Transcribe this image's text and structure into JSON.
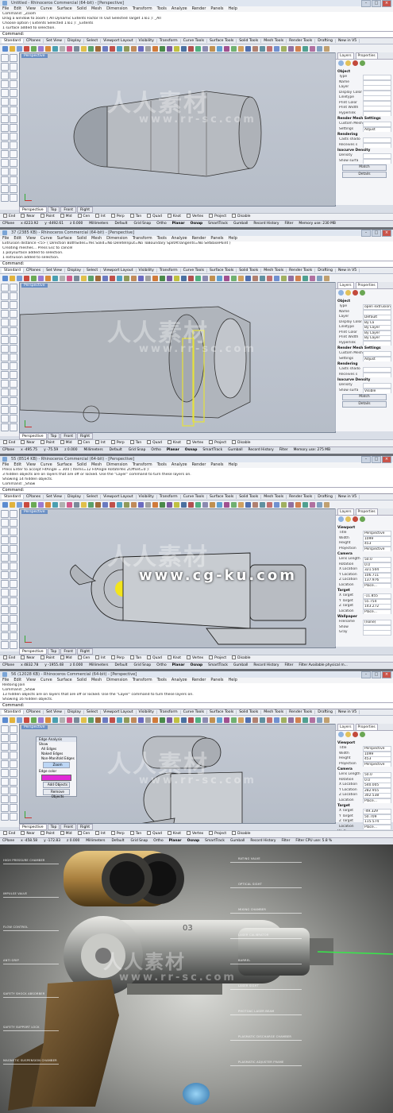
{
  "menu": [
    "File",
    "Edit",
    "View",
    "Curve",
    "Surface",
    "Solid",
    "Mesh",
    "Dimension",
    "Transform",
    "Tools",
    "Analyze",
    "Render",
    "Panels",
    "Help"
  ],
  "tabs": [
    "Standard",
    "CPlanes",
    "Set View",
    "Display",
    "Select",
    "Viewport Layout",
    "Visibility",
    "Transform",
    "Curve Tools",
    "Surface Tools",
    "Solid Tools",
    "Mesh Tools",
    "Render Tools",
    "Drafting",
    "New in V5"
  ],
  "viewport_tabs": [
    "Perspective",
    "Top",
    "Front",
    "Right"
  ],
  "osnaps": [
    "End",
    "Near",
    "Point",
    "Mid",
    "Cen",
    "Int",
    "Perp",
    "Tan",
    "Quad",
    "Knot",
    "Vertex",
    "Project",
    "Disable"
  ],
  "status_toggles": [
    "Grid Snap",
    "Ortho",
    "Planar",
    "Osnap",
    "SmartTrack",
    "Gumball",
    "Record History",
    "Filter"
  ],
  "colors": {
    "accent": "#6a8fc4",
    "bg": "#d9dee7",
    "viewport": "#c0c6d0",
    "magenta": "#e02ad6"
  },
  "screens": [
    {
      "title": "Untitled - Rhinoceros Commercial (64-bit) - [Perspective]",
      "history": [
        "Command: _Zoom",
        "Drag a window to zoom ( All  Dynamic  Extents  Factor  In  Out  Selected  Target  1To1 ): _All",
        "Choose option ( Extents  Selected  1To1 ): _Extents",
        "1 surface added to selection."
      ],
      "command": "Command:",
      "viewport_label": "Perspective",
      "panel_tabs": [
        "Layers",
        "Properties"
      ],
      "panel": [
        {
          "section": "Object"
        },
        {
          "k": "Type",
          "v": ""
        },
        {
          "k": "Name",
          "v": ""
        },
        {
          "k": "Layer",
          "v": ""
        },
        {
          "k": "Display Color",
          "v": ""
        },
        {
          "k": "Linetype",
          "v": ""
        },
        {
          "k": "Print Color",
          "v": ""
        },
        {
          "k": "Print Width",
          "v": ""
        },
        {
          "k": "Hyperlink",
          "v": ""
        },
        {
          "section": "Render Mesh Settings"
        },
        {
          "k": "Custom Mesh",
          "v": ""
        },
        {
          "k": "Settings",
          "v": "Adjust"
        },
        {
          "section": "Rendering"
        },
        {
          "k": "Casts shado",
          "v": ""
        },
        {
          "k": "Receives s",
          "v": ""
        },
        {
          "section": "Isocurve Density"
        },
        {
          "k": "Density",
          "v": ""
        },
        {
          "k": "Show surfa",
          "v": ""
        }
      ],
      "panel_buttons": [
        "Match",
        "Details"
      ],
      "status": {
        "cplane": "CPlane",
        "x": "x 4223.92",
        "y": "y -4492.61",
        "z": "z 0.000",
        "units": "Millimeters",
        "layer": "Default",
        "extra": "Memory use: 230 MB"
      }
    },
    {
      "title": "37 (2385 KB) - Rhinoceros Commercial (64-bit) - [Perspective]",
      "history": [
        "Extrusion distance <5> ( Direction  BothSides=Yes  Solid=No  DeleteInput=No  ToBoundary  SplitAtTangents=No  SetBasePoint )",
        "Creating meshes... Press Esc to cancel",
        "1 polysurface added to selection.",
        "1 extrusion added to selection."
      ],
      "command": "Command:",
      "viewport_label": "Perspective",
      "panel_tabs": [
        "Layers",
        "Properties"
      ],
      "panel": [
        {
          "section": "Object"
        },
        {
          "k": "Type",
          "v": "open extrusion"
        },
        {
          "k": "Name",
          "v": ""
        },
        {
          "k": "Layer",
          "v": "Default"
        },
        {
          "k": "Display Color",
          "v": "By La"
        },
        {
          "k": "Linetype",
          "v": "By Layer"
        },
        {
          "k": "Print Color",
          "v": "By Layer"
        },
        {
          "k": "Print Width",
          "v": "By Layer"
        },
        {
          "k": "Hyperlink",
          "v": ""
        },
        {
          "section": "Render Mesh Settings"
        },
        {
          "k": "Custom Mesh",
          "v": ""
        },
        {
          "k": "Settings",
          "v": "Adjust"
        },
        {
          "section": "Rendering"
        },
        {
          "k": "Casts shado",
          "v": ""
        },
        {
          "k": "Receives s",
          "v": ""
        },
        {
          "section": "Isocurve Density"
        },
        {
          "k": "Density",
          "v": ""
        },
        {
          "k": "Show surfa",
          "v": "Visible"
        }
      ],
      "panel_buttons": [
        "Match",
        "Details"
      ],
      "status": {
        "cplane": "CPlane",
        "x": "x -495.75",
        "y": "y -75.59",
        "z": "z 0.000",
        "units": "Millimeters",
        "layer": "Default",
        "extra": "Memory use: 275 MB"
      }
    },
    {
      "title": "55 (8514 KB) - Rhinoceros Commercial (64-bit) - [Perspective]",
      "history": [
        "Press Enter to accept  FitAngle = 300 ( Items=12  FitAngle  RotateYes  ZOffset=0 ):",
        "3 hidden objects are on layers that are off or locked.  Use the \"Layer\" command to turn these layers on.",
        "Showing 14 hidden objects.",
        "Command: _Show"
      ],
      "command": "Command:",
      "viewport_label": "Perspective",
      "panel_tabs": [
        "Layers",
        "Properties"
      ],
      "panel": [
        {
          "section": "Viewport"
        },
        {
          "k": "Title",
          "v": "Perspective"
        },
        {
          "k": "Width",
          "v": "1099"
        },
        {
          "k": "Height",
          "v": "453"
        },
        {
          "k": "Projection",
          "v": "Perspective"
        },
        {
          "section": "Camera"
        },
        {
          "k": "Lens Length",
          "v": "50.0"
        },
        {
          "k": "Rotation",
          "v": "0.0"
        },
        {
          "k": "X Location",
          "v": "321.504"
        },
        {
          "k": "Y Location",
          "v": "106.711"
        },
        {
          "k": "Z Location",
          "v": "137.976"
        },
        {
          "k": "Location",
          "v": "Place..."
        },
        {
          "section": "Target"
        },
        {
          "k": "X Target",
          "v": "-11.855"
        },
        {
          "k": "Y Target",
          "v": "55.754"
        },
        {
          "k": "Z Target",
          "v": "143.272"
        },
        {
          "k": "Location",
          "v": "Place..."
        },
        {
          "section": "Wallpaper"
        },
        {
          "k": "Filename",
          "v": "(none)"
        },
        {
          "k": "Show",
          "v": ""
        },
        {
          "k": "Gray",
          "v": ""
        }
      ],
      "panel_buttons": [],
      "status": {
        "cplane": "CPlane",
        "x": "x 4832.78",
        "y": "y -1955.48",
        "z": "z 0.000",
        "units": "Millimeters",
        "layer": "Default",
        "extra": "Filter  Available physical m..."
      }
    },
    {
      "title": "56 (12028 KB) - Rhinoceros Commercial (64-bit) - [Perspective]",
      "history": [
        "Redoing Join",
        "Command: _Show",
        "13 hidden objects are on layers that are off or locked.  Use the \"Layer\" command to turn these layers on.",
        "Showing 16 hidden objects."
      ],
      "command": "Command:",
      "viewport_label": "Perspective",
      "panel_tabs": [
        "Layers",
        "Properties"
      ],
      "panel": [
        {
          "section": "Viewport"
        },
        {
          "k": "Title",
          "v": "Perspective"
        },
        {
          "k": "Width",
          "v": "1099"
        },
        {
          "k": "Height",
          "v": "453"
        },
        {
          "k": "Projection",
          "v": "Perspective"
        },
        {
          "section": "Camera"
        },
        {
          "k": "Lens Length",
          "v": "50.0"
        },
        {
          "k": "Rotation",
          "v": "0.0"
        },
        {
          "k": "X Location",
          "v": "540.005"
        },
        {
          "k": "Y Location",
          "v": "282.955"
        },
        {
          "k": "Z Location",
          "v": "302.538"
        },
        {
          "k": "Location",
          "v": "Place..."
        },
        {
          "section": "Target"
        },
        {
          "k": "X Target",
          "v": "-49.329"
        },
        {
          "k": "Y Target",
          "v": "50.709"
        },
        {
          "k": "Z Target",
          "v": "115.574"
        },
        {
          "k": "Location",
          "v": "Place..."
        },
        {
          "section": "Wallpaper"
        },
        {
          "k": "Filename",
          "v": "(none)"
        },
        {
          "k": "Show",
          "v": ""
        },
        {
          "k": "Gray",
          "v": ""
        }
      ],
      "panel_buttons": [],
      "edge_analysis": {
        "title": "Edge Analysis",
        "show_label": "Show",
        "options": [
          "All Edges",
          "Naked Edges",
          "Non-Manifold Edges"
        ],
        "zoom": "Zoom",
        "edge_color_label": "Edge color",
        "add": "Add Objects",
        "remove": "Remove Objects"
      },
      "status": {
        "cplane": "CPlane",
        "x": "x -458.58",
        "y": "y -172.83",
        "z": "z 0.000",
        "units": "Millimeters",
        "layer": "Default",
        "extra": "Filter  CPU use: 5.8 %"
      }
    }
  ],
  "render": {
    "callouts_left": [
      "HIGH PRESSURE CHAMBER",
      "IMPULSE VALVE",
      "FLOW CONTROL",
      "ANTI GRIP",
      "SAFETY SHOCK ABSORBER",
      "SAFETY SUPPORT LOCK",
      "MAGNETIC SUSPENSION CHAMBER"
    ],
    "callouts_right": [
      "RATING VALVE",
      "OPTICAL SIGHT",
      "MIXING CHAMBER",
      "LASER CALIBRATOR",
      "BARREL",
      "LASER SIGHT",
      "PHOTOAC LASER BEAM",
      "PLASMATIC DISCHARGE CHAMBER",
      "PLASMATIC ADJUSTER FRAME"
    ],
    "barrel_mark": "03",
    "laser_color": "#37e84a"
  },
  "watermarks": {
    "cn": "人人素材",
    "url": "www.rr-sc.com",
    "cg": "www.cg-ku.com"
  }
}
